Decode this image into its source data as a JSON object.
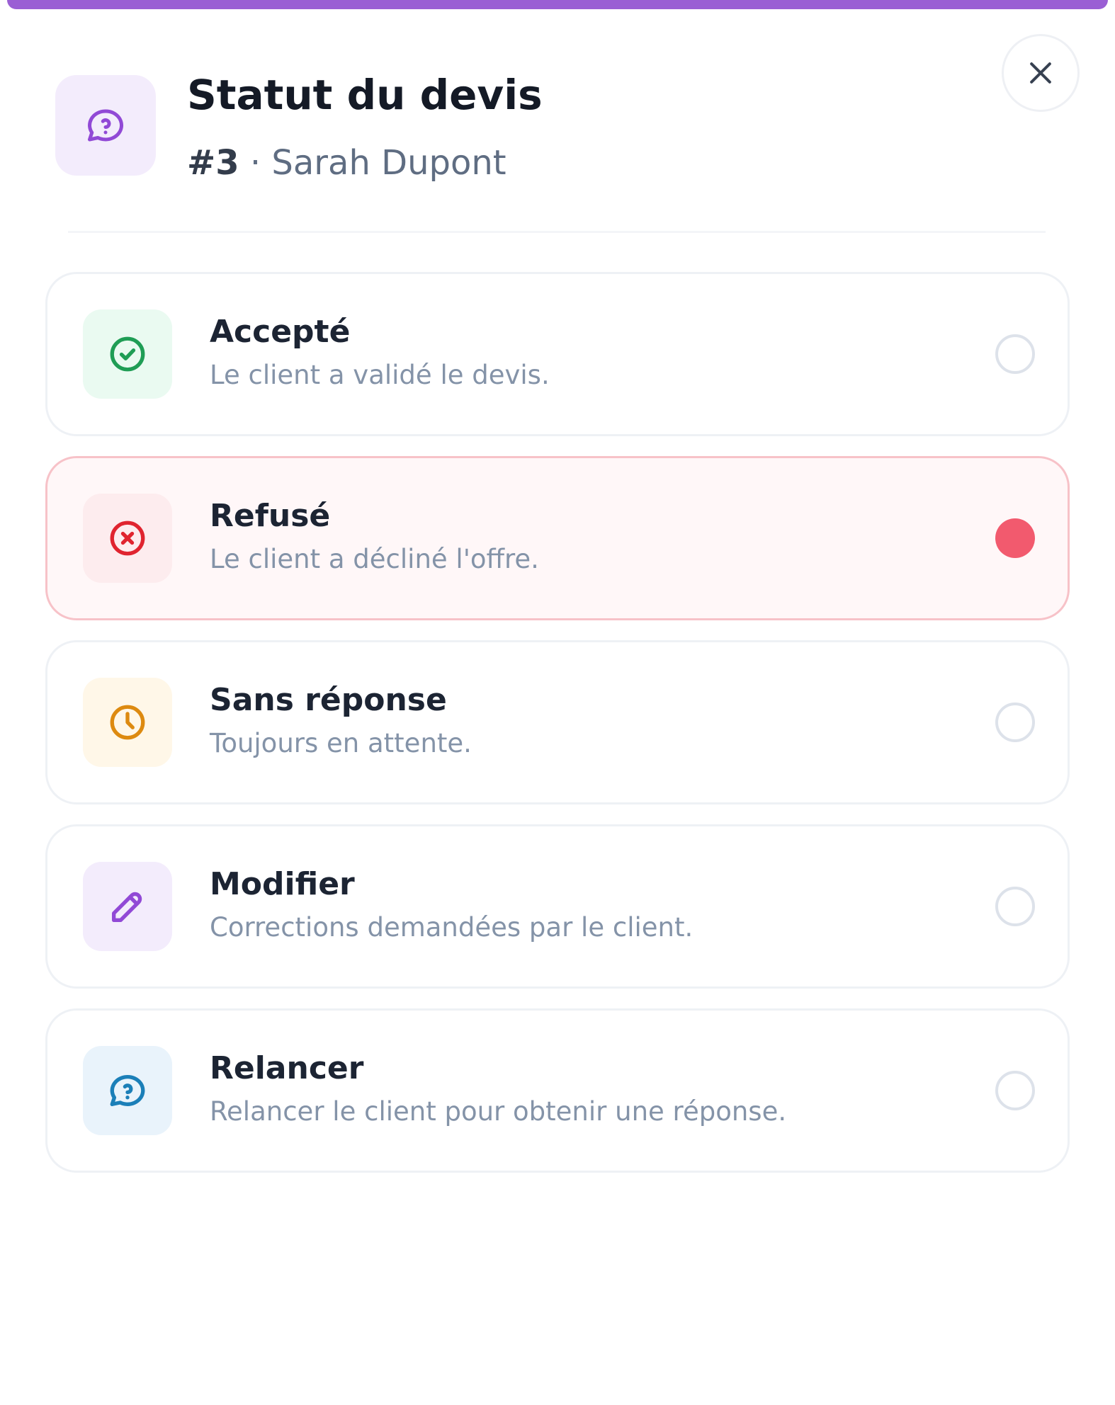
{
  "header": {
    "title": "Statut du devis",
    "quote_number": "#3",
    "separator": "·",
    "client_name": "Sarah Dupont",
    "icon": "question-bubble-icon",
    "accent_color": "#9a5fd4"
  },
  "close_button": {
    "icon": "close-icon"
  },
  "options": [
    {
      "key": "accepte",
      "label": "Accepté",
      "description": "Le client a validé le devis.",
      "icon": "check-circle-icon",
      "color": "#1f9d55",
      "icon_bg": "#eafaf1",
      "selected": false
    },
    {
      "key": "refuse",
      "label": "Refusé",
      "description": "Le client a décliné l'offre.",
      "icon": "x-circle-icon",
      "color": "#e0242f",
      "icon_bg": "#fdecee",
      "selected": true,
      "radio_color": "#f25a6e"
    },
    {
      "key": "sans_reponse",
      "label": "Sans réponse",
      "description": "Toujours en attente.",
      "icon": "clock-icon",
      "color": "#dd8a10",
      "icon_bg": "#fff7e8",
      "selected": false
    },
    {
      "key": "modifier",
      "label": "Modifier",
      "description": "Corrections demandées par le client.",
      "icon": "pencil-icon",
      "color": "#9149d6",
      "icon_bg": "#f3ecfc",
      "selected": false
    },
    {
      "key": "relancer",
      "label": "Relancer",
      "description": "Relancer le client pour obtenir une réponse.",
      "icon": "question-bubble-icon",
      "color": "#1b7fb8",
      "icon_bg": "#e9f3fb",
      "selected": false
    }
  ]
}
